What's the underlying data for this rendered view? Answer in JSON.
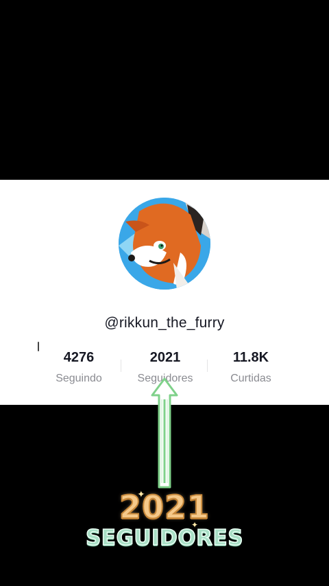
{
  "profile": {
    "username": "@rikkun_the_furry",
    "avatar_icon": "fox-avatar-icon",
    "stats": [
      {
        "value": "4276",
        "label": "Seguindo"
      },
      {
        "value": "2021",
        "label": "Seguidores"
      },
      {
        "value": "11.8K",
        "label": "Curtidas"
      }
    ]
  },
  "overlay": {
    "arrow_icon": "up-arrow-icon",
    "caption_number": "2021",
    "caption_word": "SEGUIDORES"
  },
  "colors": {
    "background": "#000000",
    "card": "#ffffff",
    "arrow": "#7fd18a",
    "caption_number": "#f5c98a",
    "caption_word": "#a9dfc6"
  }
}
